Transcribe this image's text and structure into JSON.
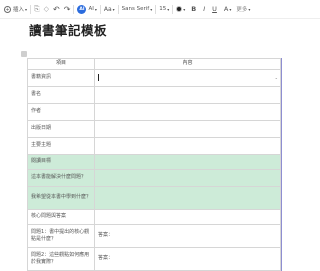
{
  "toolbar": {
    "insert_label": "插入",
    "ai_label": "AI",
    "fontsize_icon_label": "Aa",
    "font_family": "Sans Serif",
    "font_size": "15",
    "bold_label": "B",
    "italic_label": "I",
    "underline_label": "U",
    "textcolor_label": "A",
    "more_label": "更多"
  },
  "doc": {
    "title": "讀書筆記模板"
  },
  "table": {
    "headers": [
      "項目",
      "內容"
    ],
    "rows": [
      {
        "item": "書籍資訊",
        "content": ""
      },
      {
        "item": "書名",
        "content": ""
      },
      {
        "item": "作者",
        "content": ""
      },
      {
        "item": "出版日期",
        "content": ""
      },
      {
        "item": "主要主題",
        "content": ""
      },
      {
        "item": "閱讀目標",
        "content": ""
      },
      {
        "item": "這本書能解決什麼問題？",
        "content": ""
      },
      {
        "item": "我希望從本書中學到什麼？",
        "content": ""
      },
      {
        "item": "核心問題與答案",
        "content": ""
      },
      {
        "item": "問題1：書中提出的核心觀點是什麼？",
        "content": "答案："
      },
      {
        "item": "問題2：這些觀點如何應用於我實際？",
        "content": "答案："
      }
    ]
  },
  "colors": {
    "highlight_green": "#cdebd8",
    "accent_blue": "#2b6cde",
    "table_border": "#d6d6d6",
    "selection_border": "#8e8ed1"
  }
}
